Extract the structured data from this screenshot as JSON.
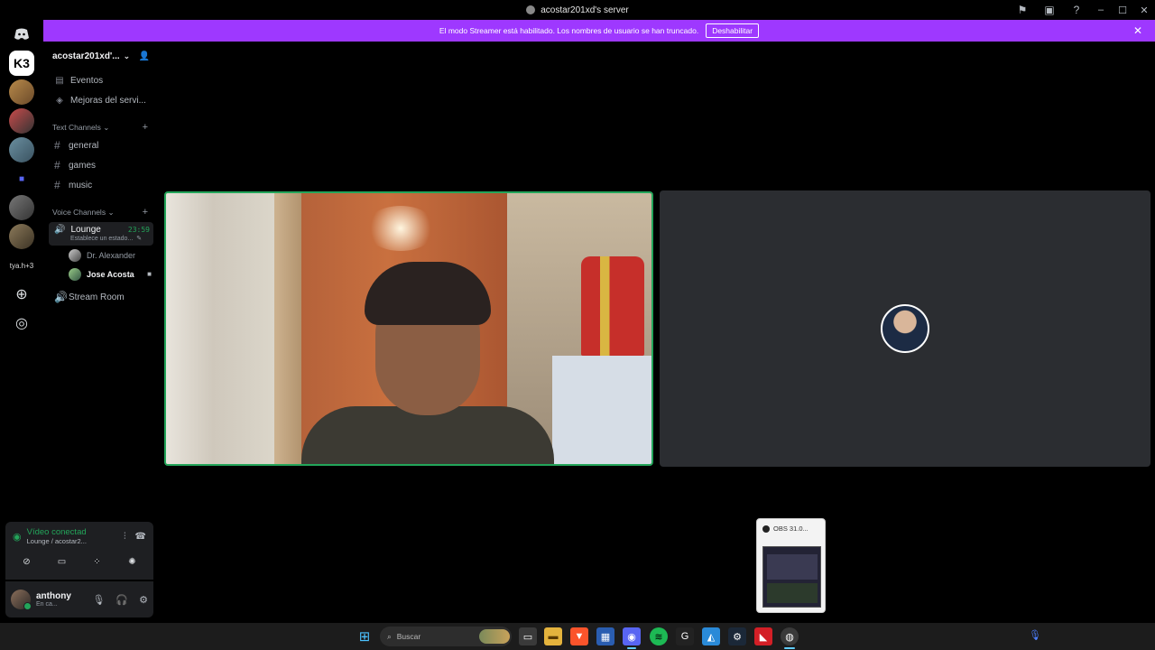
{
  "window": {
    "title": "acostar201xd's server",
    "icons": [
      "inbox-flag-icon",
      "inbox-icon",
      "help-icon"
    ],
    "controls": [
      "minimize",
      "maximize",
      "close"
    ]
  },
  "banner": {
    "message": "El modo Streamer está habilitado. Los nombres de usuario se han truncado.",
    "button": "Deshabilitar",
    "color": "#9e38ff"
  },
  "rail": {
    "servers": [
      "discord-home",
      "k3-server",
      "server-2",
      "server-3",
      "server-4",
      "folder",
      "server-5",
      "server-6",
      "text-server",
      "add-server",
      "explore"
    ],
    "k3_label": "K3",
    "text_server_label": "tya.h+3"
  },
  "sidebar": {
    "server_name": "acostar201xd'...",
    "top_items": [
      {
        "label": "Eventos",
        "icon": "calendar-icon"
      },
      {
        "label": "Mejoras del servi...",
        "icon": "boost-icon"
      }
    ],
    "text_section": "Text Channels",
    "text_channels": [
      "general",
      "games",
      "music"
    ],
    "voice_section": "Voice Channels",
    "active_voice": {
      "name": "Lounge",
      "timer": "23:59",
      "status": "Establece un estado..."
    },
    "members": [
      {
        "name": "Dr. Alexander",
        "active": false
      },
      {
        "name": "Jose Acosta",
        "active": true
      }
    ],
    "other_voice": "Stream Room"
  },
  "voice_panel": {
    "status": "Vídeo conectad",
    "location": "Lounge / acostar2...",
    "accent": "#23a55a"
  },
  "user_panel": {
    "name": "anthony",
    "status": "En ca..."
  },
  "obs_preview": {
    "title": "OBS 31.0..."
  },
  "taskbar": {
    "search_placeholder": "Buscar",
    "apps": [
      "windows-start",
      "files",
      "file-explorer",
      "brave",
      "store",
      "discord",
      "spotify",
      "g-hub",
      "photos",
      "steam",
      "amd",
      "obs"
    ]
  }
}
